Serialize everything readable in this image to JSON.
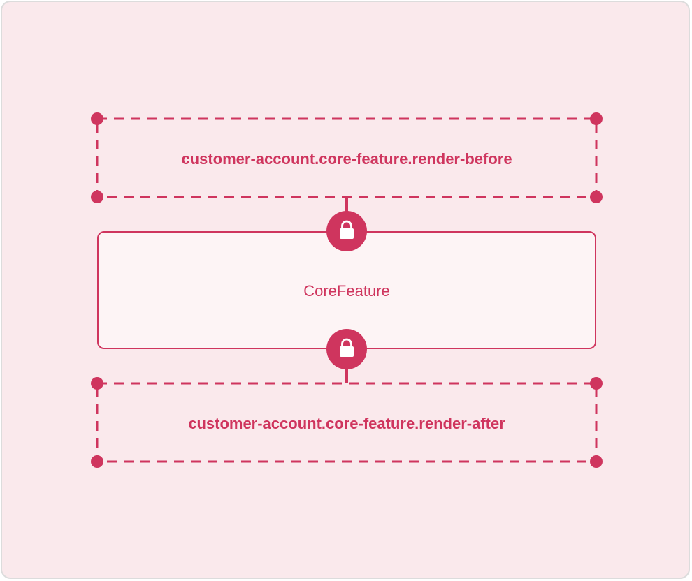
{
  "colors": {
    "accent": "#cf355e",
    "panel_background": "#fae9ec",
    "core_background": "#fdf4f5",
    "frame_border": "#dcdcdc",
    "icon_glyph": "#ffffff"
  },
  "diagram": {
    "before_target": {
      "label": "customer-account.core-feature.render-before",
      "style": "dashed"
    },
    "core_component": {
      "label": "CoreFeature"
    },
    "after_target": {
      "label": "customer-account.core-feature.render-after",
      "style": "dashed"
    },
    "connectors": [
      {
        "icon": "lock-icon",
        "between": "render-before / CoreFeature"
      },
      {
        "icon": "lock-icon",
        "between": "CoreFeature / render-after"
      }
    ]
  }
}
